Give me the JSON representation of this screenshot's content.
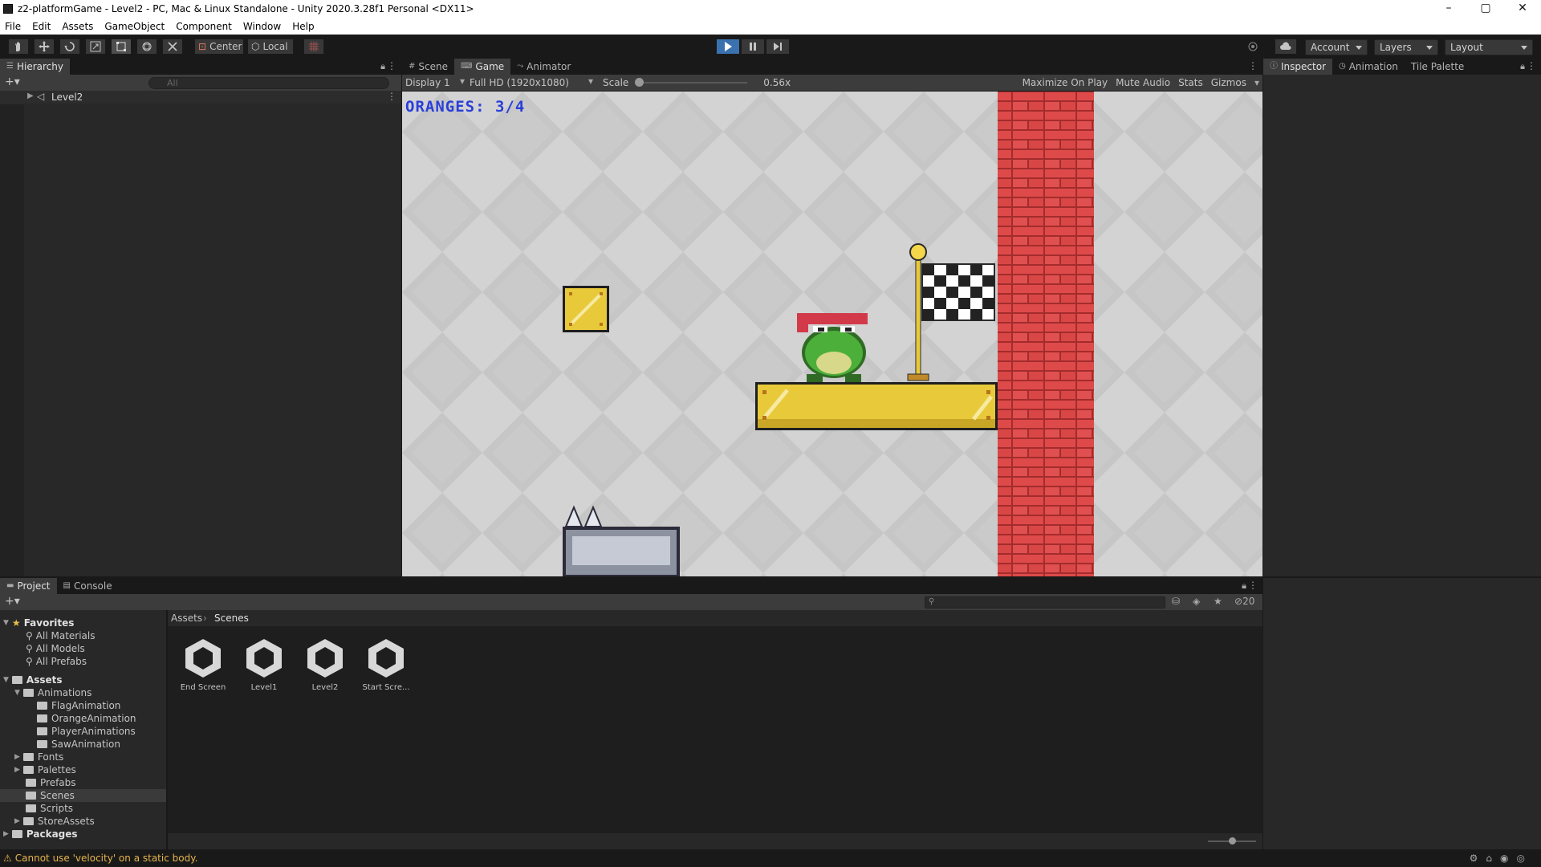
{
  "window": {
    "title": "z2-platformGame - Level2 - PC, Mac & Linux Standalone - Unity 2020.3.28f1 Personal <DX11>",
    "controls": [
      "–",
      "▢",
      "✕"
    ]
  },
  "menu": [
    "File",
    "Edit",
    "Assets",
    "GameObject",
    "Component",
    "Window",
    "Help"
  ],
  "toolbar": {
    "pivot": "Center",
    "space": "Local",
    "account": "Account",
    "layers": "Layers",
    "layout": "Layout"
  },
  "hierarchy": {
    "tab": "Hierarchy",
    "search_placeholder": "All",
    "items": [
      "Level2"
    ]
  },
  "center_tabs": [
    "Scene",
    "Game",
    "Animator"
  ],
  "game_toolbar": {
    "display": "Display 1",
    "resolution": "Full HD (1920x1080)",
    "scale_label": "Scale",
    "scale_value": "0.56x",
    "maximize": "Maximize On Play",
    "mute": "Mute Audio",
    "stats": "Stats",
    "gizmos": "Gizmos"
  },
  "game": {
    "hud": "ORANGES: 3/4"
  },
  "right_tabs": [
    "Inspector",
    "Animation",
    "Tile Palette"
  ],
  "project": {
    "tabs": [
      "Project",
      "Console"
    ],
    "favorites_label": "Favorites",
    "favorites": [
      "All Materials",
      "All Models",
      "All Prefabs"
    ],
    "assets_label": "Assets",
    "animations_label": "Animations",
    "animation_folders": [
      "FlagAnimation",
      "OrangeAnimation",
      "PlayerAnimations",
      "SawAnimation"
    ],
    "asset_folders": [
      "Fonts",
      "Palettes",
      "Prefabs",
      "Scenes",
      "Scripts",
      "StoreAssets"
    ],
    "packages_label": "Packages",
    "breadcrumb": [
      "Assets",
      "Scenes"
    ],
    "scene_files": [
      "End Screen",
      "Level1",
      "Level2",
      "Start Scre..."
    ],
    "hidden_count": "20"
  },
  "status": {
    "message": "Cannot use 'velocity' on a static body."
  },
  "colors": {
    "accent_play": "#3a72b0",
    "hud_text": "#2a3fd8",
    "brick": "#d94848",
    "platform": "#e8c93a",
    "frog": "#4caf3a"
  }
}
